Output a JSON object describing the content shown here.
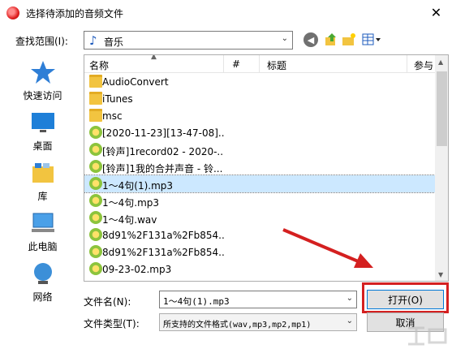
{
  "window": {
    "title": "选择待添加的音频文件"
  },
  "toolbar": {
    "look_in_label": "查找范围(I):",
    "look_in_value": "音乐",
    "icons": [
      "back-icon",
      "up-folder-icon",
      "new-folder-icon",
      "view-menu-icon"
    ]
  },
  "places": [
    {
      "label": "快速访问",
      "icon": "star-icon"
    },
    {
      "label": "桌面",
      "icon": "desktop-icon"
    },
    {
      "label": "库",
      "icon": "library-icon"
    },
    {
      "label": "此电脑",
      "icon": "computer-icon"
    },
    {
      "label": "网络",
      "icon": "network-icon"
    }
  ],
  "columns": {
    "name": "名称",
    "num": "#",
    "title": "标题",
    "artist": "参与"
  },
  "files": [
    {
      "name": "AudioConvert",
      "type": "folder"
    },
    {
      "name": "iTunes",
      "type": "folder"
    },
    {
      "name": "msc",
      "type": "folder"
    },
    {
      "name": "[2020-11-23][13-47-08]...",
      "type": "audio"
    },
    {
      "name": "[铃声]1record02 - 2020-...",
      "type": "audio"
    },
    {
      "name": "[铃声]1我的合并声音 - 铃...",
      "type": "audio"
    },
    {
      "name": "1～4句(1).mp3",
      "type": "audio",
      "selected": true
    },
    {
      "name": "1～4句.mp3",
      "type": "audio"
    },
    {
      "name": "1～4句.wav",
      "type": "audio"
    },
    {
      "name": "8d91%2F131a%2Fb854...",
      "type": "audio"
    },
    {
      "name": "8d91%2F131a%2Fb854...",
      "type": "audio"
    },
    {
      "name": "09-23-02.mp3",
      "type": "audio"
    }
  ],
  "filename": {
    "label": "文件名(N):",
    "value": "1～4句(1).mp3"
  },
  "filetype": {
    "label": "文件类型(T):",
    "value": "所支持的文件格式(wav,mp3,mp2,mp1)"
  },
  "buttons": {
    "open": "打开(O)",
    "cancel": "取消"
  },
  "colors": {
    "selection": "#cce8ff",
    "annotation_red": "#d42020",
    "accent": "#0078d7"
  }
}
